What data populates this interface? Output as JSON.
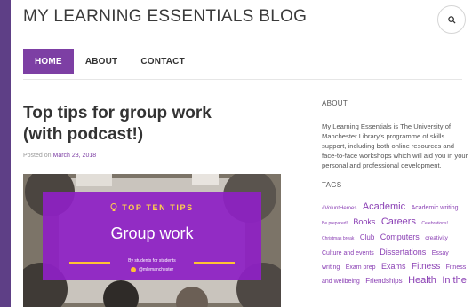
{
  "site": {
    "title": "MY LEARNING ESSENTIALS BLOG"
  },
  "colors": {
    "accent": "#7d3fa4",
    "background": "#5e3f86",
    "card": "#8e20c4",
    "highlight": "#ffc233"
  },
  "header": {
    "search_icon": "search-icon"
  },
  "nav": {
    "items": [
      {
        "label": "HOME",
        "active": true
      },
      {
        "label": "ABOUT",
        "active": false
      },
      {
        "label": "CONTACT",
        "active": false
      }
    ]
  },
  "post": {
    "title": "Top tips for group work (with podcast!)",
    "posted_on": "Posted on",
    "date": "March 23, 2018",
    "image": {
      "heading": "TOP TEN TIPS",
      "title": "Group work",
      "byline": "By students for students",
      "handle": "@mlemanchester",
      "icon": "lightbulb-icon"
    }
  },
  "sidebar": {
    "about": {
      "title": "ABOUT",
      "text": "My Learning Essentials is The University of Manchester Library’s programme of skills support, including both online resources and face-to-face workshops which will aid you in your personal and professional development."
    },
    "tags": {
      "title": "TAGS",
      "items": [
        {
          "label": "#VoluntHeroes",
          "size": 6
        },
        {
          "label": "Academic",
          "size": 11
        },
        {
          "label": "Academic writing",
          "size": 7
        },
        {
          "label": "Be prepared!",
          "size": 5
        },
        {
          "label": "Books",
          "size": 9
        },
        {
          "label": "Careers",
          "size": 11
        },
        {
          "label": "Celebrations!",
          "size": 5
        },
        {
          "label": "Christmas break",
          "size": 5
        },
        {
          "label": "Club",
          "size": 8
        },
        {
          "label": "Computers",
          "size": 9
        },
        {
          "label": "creativity",
          "size": 6.5
        },
        {
          "label": "Culture and events",
          "size": 7
        },
        {
          "label": "Dissertations",
          "size": 9
        },
        {
          "label": "Essay writing",
          "size": 7
        },
        {
          "label": "Exam prep",
          "size": 7
        },
        {
          "label": "Exams",
          "size": 9
        },
        {
          "label": "Fitness",
          "size": 10
        },
        {
          "label": "Fitness and wellbeing",
          "size": 7
        },
        {
          "label": "Friendships",
          "size": 8
        },
        {
          "label": "Health",
          "size": 11
        },
        {
          "label": "In the",
          "size": 11
        }
      ]
    }
  }
}
